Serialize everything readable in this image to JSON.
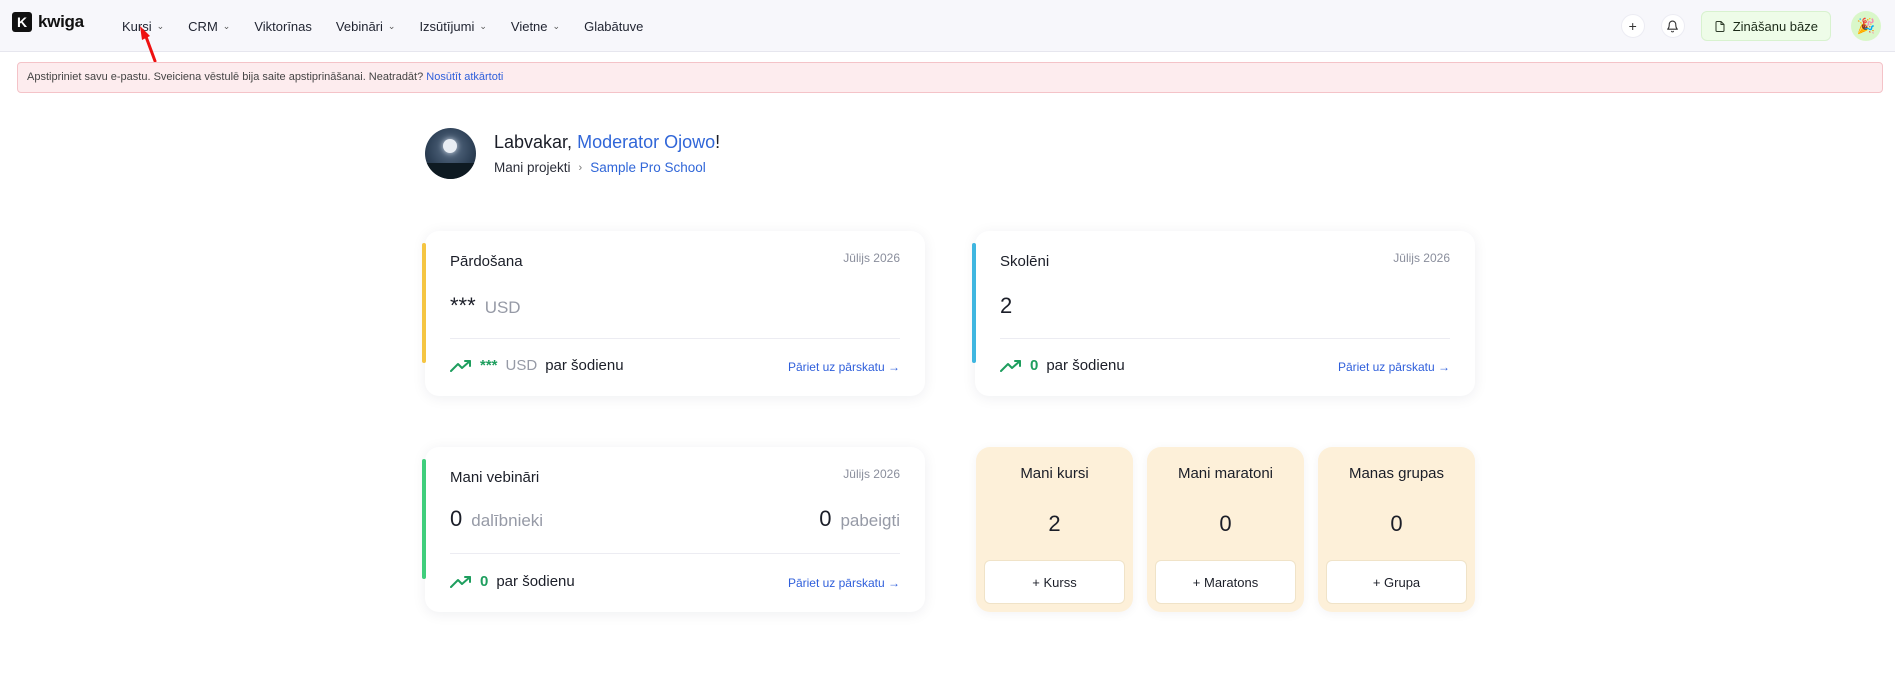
{
  "app": {
    "logo_letter": "K",
    "logo_text": "kwiga"
  },
  "nav": {
    "items": [
      {
        "label": "Kursi",
        "dropdown": true
      },
      {
        "label": "CRM",
        "dropdown": true
      },
      {
        "label": "Viktorīnas",
        "dropdown": false
      },
      {
        "label": "Vebināri",
        "dropdown": true
      },
      {
        "label": "Izsūtījumi",
        "dropdown": true
      },
      {
        "label": "Vietne",
        "dropdown": true
      },
      {
        "label": "Glabātuve",
        "dropdown": false
      }
    ],
    "knowledge_base_label": "Zināšanu bāze"
  },
  "alert": {
    "text": "Apstipriniet savu e-pastu. Sveiciena vēstulē bija saite apstiprināšanai. Neatradāt?",
    "link": "Nosūtīt atkārtoti"
  },
  "greeting": {
    "prefix": "Labvakar,",
    "name": "Moderator Ojowo",
    "suffix": "!",
    "crumb_root": "Mani projekti",
    "crumb_project": "Sample Pro School"
  },
  "sales_card": {
    "title": "Pārdošana",
    "date": "Jūlijs 2026",
    "value": "***",
    "unit": "USD",
    "today_value": "***",
    "today_unit": "USD",
    "today_label": "par šodienu",
    "link": "Pāriet uz pārskatu →",
    "accent_color": "#f5c542"
  },
  "students_card": {
    "title": "Skolēni",
    "date": "Jūlijs 2026",
    "value": "2",
    "today_value": "0",
    "today_label": "par šodienu",
    "link": "Pāriet uz pārskatu →",
    "accent_color": "#3fb6e0"
  },
  "webinars_card": {
    "title": "Mani vebināri",
    "date": "Jūlijs 2026",
    "participants_value": "0",
    "participants_label": "dalībnieki",
    "finished_value": "0",
    "finished_label": "pabeigti",
    "today_value": "0",
    "today_label": "par šodienu",
    "link": "Pāriet uz pārskatu →",
    "accent_color": "#3fce7c"
  },
  "mini_cards": [
    {
      "title": "Mani kursi",
      "count": "2",
      "button": "+ Kurss"
    },
    {
      "title": "Mani maratoni",
      "count": "0",
      "button": "+ Maratons"
    },
    {
      "title": "Manas grupas",
      "count": "0",
      "button": "+ Grupa"
    }
  ],
  "colors": {
    "link": "#3066d8",
    "trend_green": "#1e9e5e",
    "mini_bg": "#fdf0d9",
    "alert_bg": "#fdecee"
  }
}
